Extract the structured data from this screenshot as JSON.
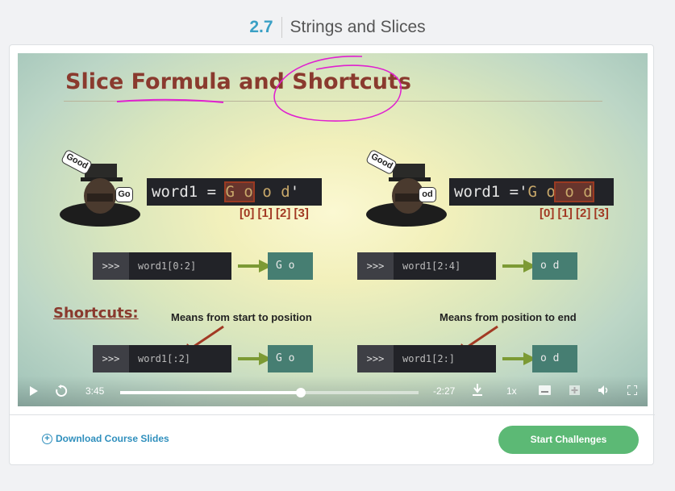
{
  "header": {
    "lesson_number": "2.7",
    "lesson_title": "Strings and Slices"
  },
  "slide": {
    "title": "Slice Formula and Shortcuts",
    "left_example": {
      "bubble_hat": "Good",
      "bubble_speech": "Go",
      "code": "word1 = Good'",
      "code_parts": [
        "word1 = ",
        "G",
        "o",
        "o",
        "d",
        "'"
      ],
      "indices": "[0] [1] [2] [3]"
    },
    "right_example": {
      "bubble_hat": "Good",
      "bubble_speech": "od",
      "code_parts": [
        "word1 ='",
        "G",
        "o",
        "o",
        "d"
      ],
      "indices": "[0] [1] [2] [3]"
    },
    "rows": [
      {
        "prompt": ">>>",
        "code": "word1[0:2]",
        "result": "G o"
      },
      {
        "prompt": ">>>",
        "code": "word1[2:4]",
        "result": "o d"
      },
      {
        "prompt": ">>>",
        "code": "word1[:2]",
        "result": "G o"
      },
      {
        "prompt": ">>>",
        "code": "word1[2:]",
        "result": "o d"
      }
    ],
    "shortcuts_label": "Shortcuts:",
    "note_left": "Means from start to position",
    "note_right": "Means from position to end"
  },
  "player": {
    "elapsed": "3:45",
    "remaining": "-2:27",
    "speed": "1x",
    "progress_fraction": 0.605,
    "icons": [
      "play-icon",
      "replay-icon",
      "download-icon",
      "captions-icon",
      "add-icon",
      "volume-icon",
      "fullscreen-icon"
    ]
  },
  "footer": {
    "download_label": "Download Course Slides",
    "start_label": "Start Challenges"
  },
  "colors": {
    "accent_blue": "#3aa0c5",
    "start_green": "#5cb975",
    "slide_title": "#8a3a2e",
    "ink": "#e020d0"
  }
}
